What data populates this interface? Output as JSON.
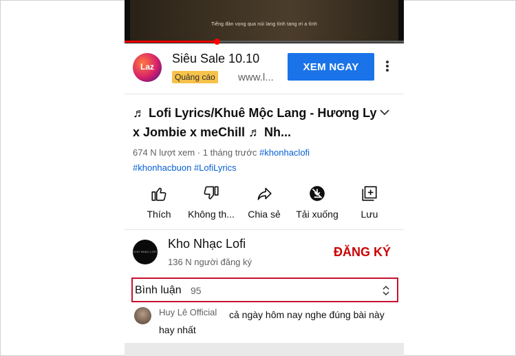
{
  "video": {
    "subtitle": "Tiếng đàn vọng qua núi lang tình tang ơi a tình",
    "progress_fraction": 0.33
  },
  "ad": {
    "logo_text": "Laz",
    "title": "Siêu Sale 10.10",
    "badge": "Quảng cáo",
    "url": "www.l...",
    "cta_label": "XEM NGAY",
    "more_icon": "vertical-dots-icon",
    "colors": {
      "cta": "#1a73e8",
      "badge": "#f7c24a"
    }
  },
  "video_info": {
    "title": "♬ Lofi Lyrics/Khuê Mộc Lang - Hương Ly x Jombie x meChill ♬ Nh...",
    "views": "674 N lượt xem · 1 tháng trước",
    "tags": [
      "#khonhaclofi",
      "#khonhacbuon",
      "#LofiLyrics"
    ]
  },
  "actions": [
    {
      "label": "Thích",
      "icon": "thumbs-up-icon"
    },
    {
      "label": "Không th...",
      "icon": "thumbs-down-icon"
    },
    {
      "label": "Chia sẻ",
      "icon": "share-icon"
    },
    {
      "label": "Tải xuống",
      "icon": "download-disabled-icon"
    },
    {
      "label": "Lưu",
      "icon": "save-playlist-icon"
    }
  ],
  "channel": {
    "avatar_text": "KHO NHẠC LOFI",
    "name": "Kho Nhạc Lofi",
    "subscribers": "136 N người đăng ký",
    "subscribe_label": "ĐĂNG KÝ",
    "subscribe_color": "#cc0000"
  },
  "comments": {
    "label": "Bình luận",
    "count": "95",
    "highlight_color": "#c8102e",
    "top_comment": {
      "author": "Huy Lê Official",
      "text": "cả ngày hôm nay nghe đúng bài này hay nhất"
    }
  }
}
